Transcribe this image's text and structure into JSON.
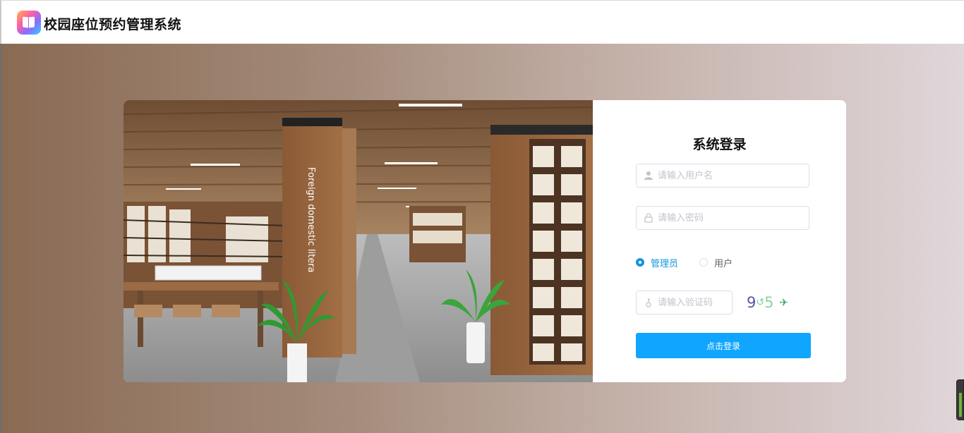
{
  "header": {
    "app_title": "校园座位预约管理系统",
    "logo_icon": "book-logo-icon"
  },
  "photo": {
    "sign_text": "Foreign domestic litera"
  },
  "login": {
    "title": "系统登录",
    "username_placeholder": "请输入用户名",
    "password_placeholder": "请输入密码",
    "roles": [
      {
        "label": "管理员",
        "selected": true
      },
      {
        "label": "用户",
        "selected": false
      }
    ],
    "captcha_placeholder": "请输入验证码",
    "captcha_chars": [
      {
        "char": "9",
        "color": "#5b55a8"
      },
      {
        "char": "↺",
        "color": "#7ad39a"
      },
      {
        "char": "5",
        "color": "#8fd3a0"
      },
      {
        "char": "✈",
        "color": "#3ea86a"
      }
    ],
    "submit_label": "点击登录",
    "accent_color": "#10a6ff"
  }
}
